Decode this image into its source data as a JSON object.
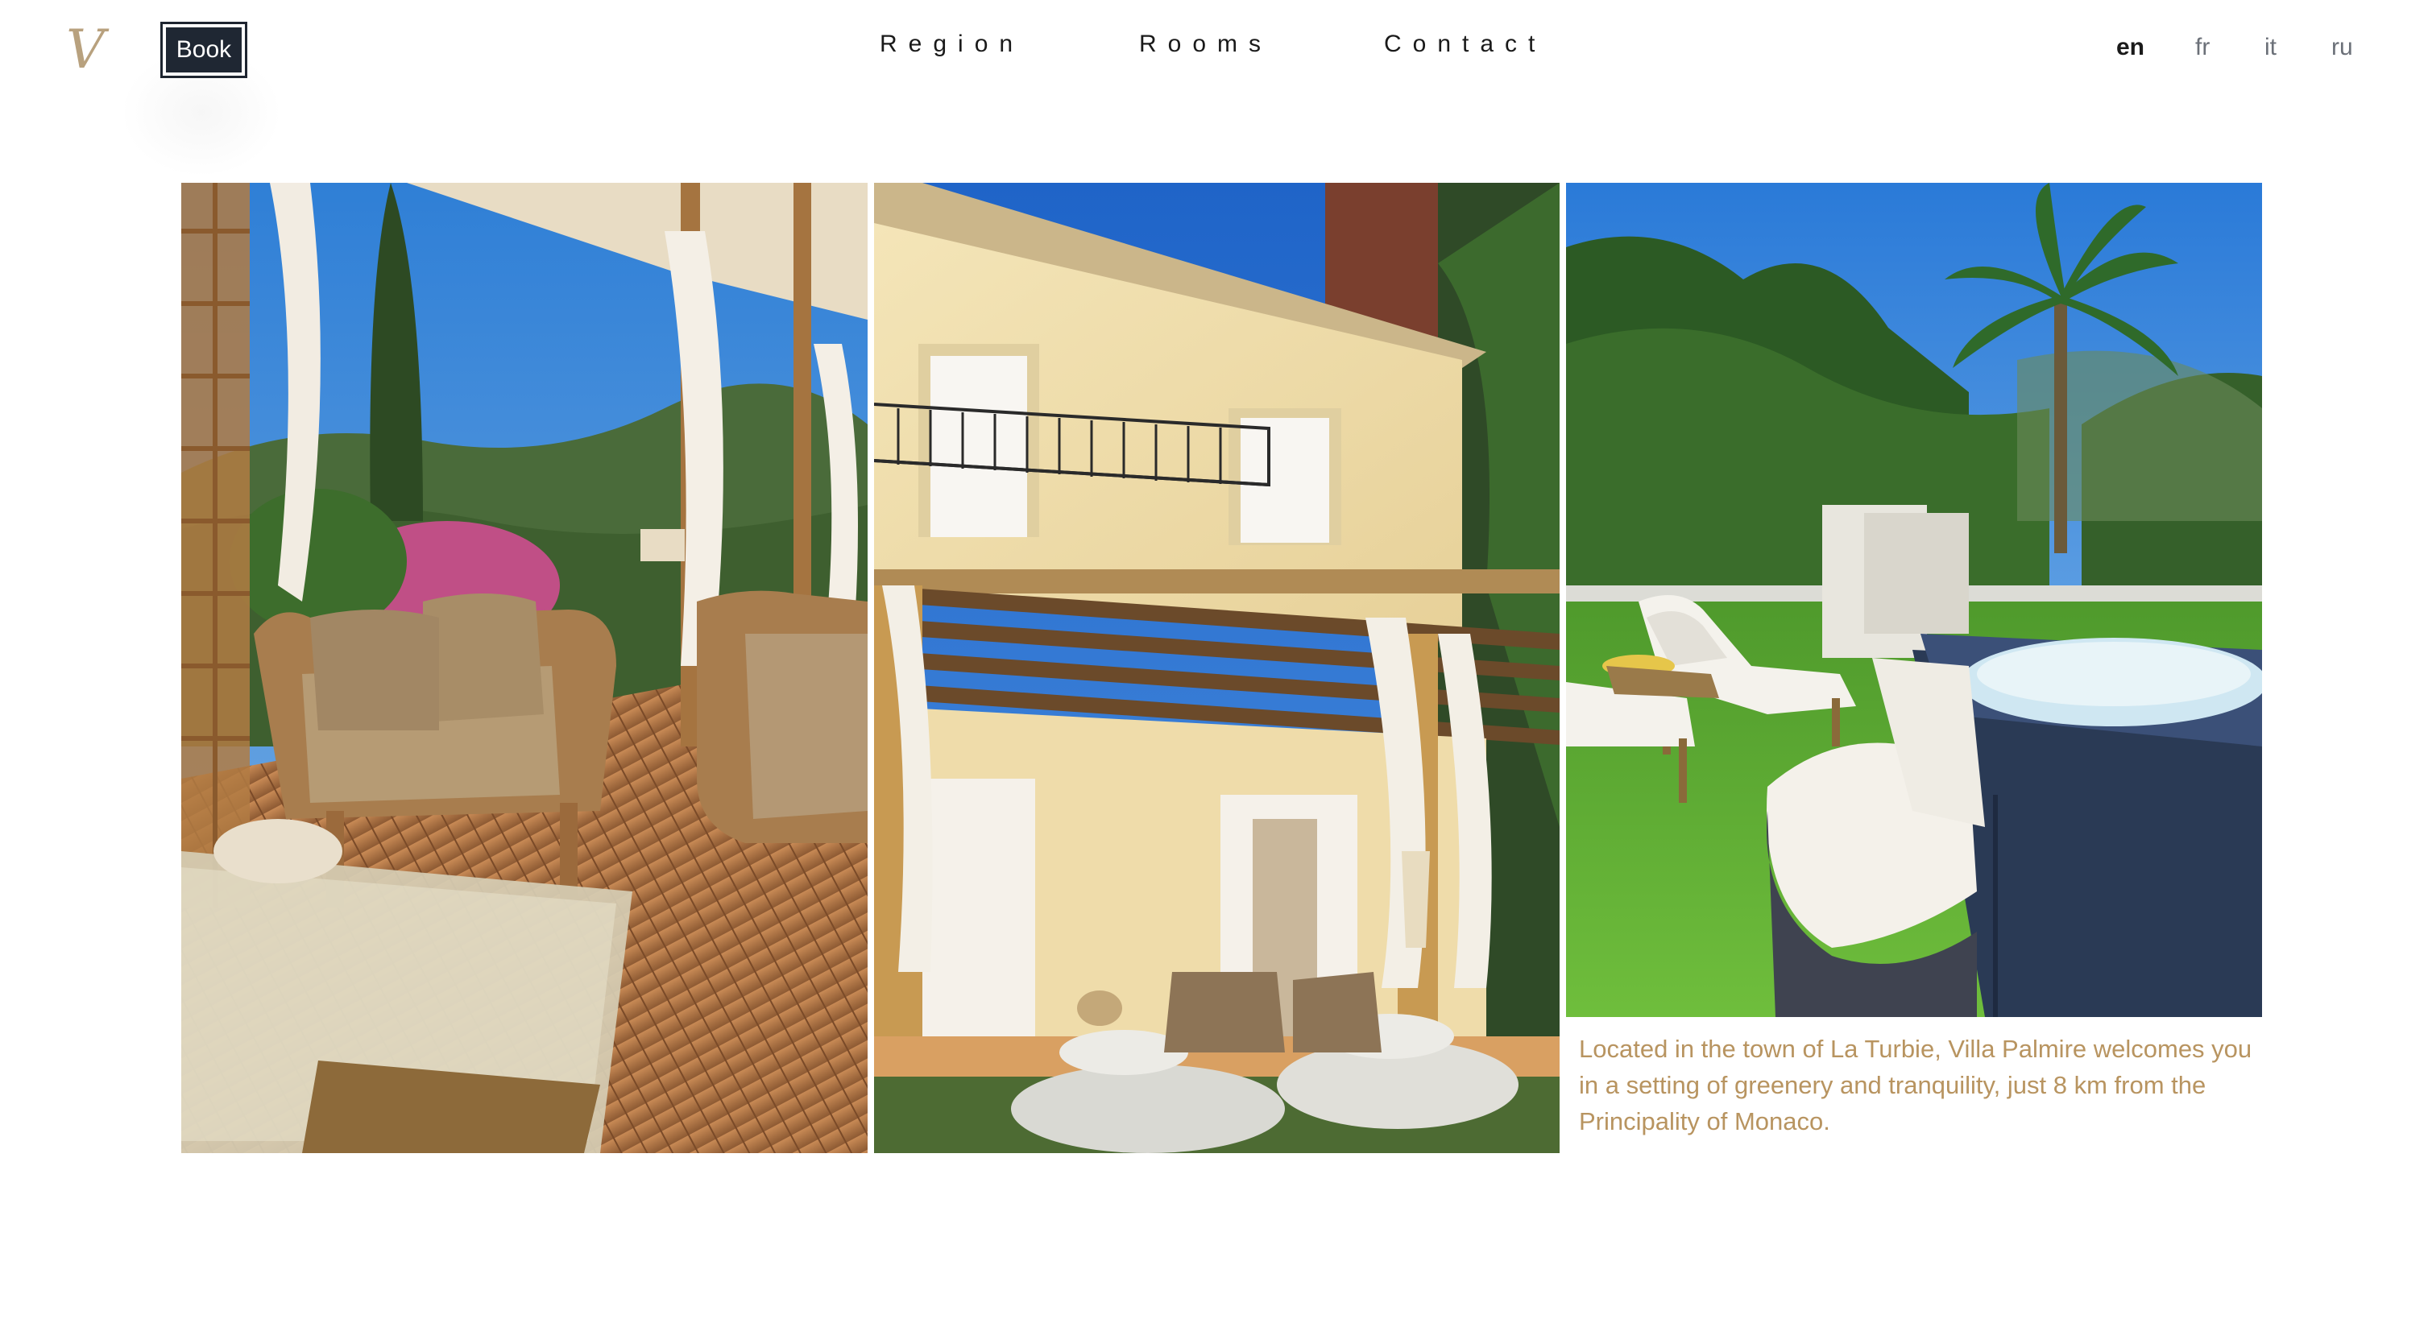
{
  "header": {
    "logo_icon": "script-v-monogram",
    "logo_glyph": "V",
    "book_label": "Book",
    "nav": [
      {
        "label": "Region"
      },
      {
        "label": "Rooms"
      },
      {
        "label": "Contact"
      }
    ],
    "languages": [
      {
        "label": "en",
        "active": true
      },
      {
        "label": "fr",
        "active": false
      },
      {
        "label": "it",
        "active": false
      },
      {
        "label": "ru",
        "active": false
      }
    ]
  },
  "gallery": {
    "photos": [
      {
        "subject": "terrace with rattan armchairs and glass table"
      },
      {
        "subject": "villa facade with pergola and floor cushions"
      },
      {
        "subject": "garden with sun loungers and hot tub"
      }
    ],
    "caption": "Located in the town of La Turbie, Villa Palmire welcomes you in a setting of greenery and tranquility, just 8 km from the Principality of Monaco."
  },
  "colors": {
    "accent_gold": "#b89460",
    "button_dark": "#1f2733",
    "text_dark": "#1a1a1a",
    "text_muted": "#6b7078"
  }
}
